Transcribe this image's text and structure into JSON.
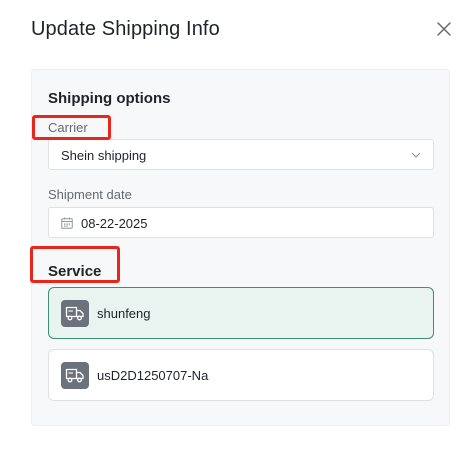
{
  "dialog": {
    "title": "Update Shipping Info",
    "close_icon": "close-icon"
  },
  "shipping_options": {
    "title": "Shipping options",
    "carrier": {
      "label": "Carrier",
      "value": "Shein shipping",
      "icon": "chevron-down-icon"
    },
    "shipment_date": {
      "label": "Shipment date",
      "value": "08-22-2025",
      "icon": "calendar-icon"
    }
  },
  "service": {
    "title": "Service",
    "options": [
      {
        "name": "shunfeng",
        "selected": true,
        "icon": "truck-icon"
      },
      {
        "name": "usD2D1250707-Na",
        "selected": false,
        "icon": "truck-icon"
      }
    ]
  },
  "colors": {
    "selected_bg": "#e9f3ef",
    "selected_border": "#3d8f74",
    "highlight": "#e8261b",
    "icon_bg": "#6b727b"
  }
}
